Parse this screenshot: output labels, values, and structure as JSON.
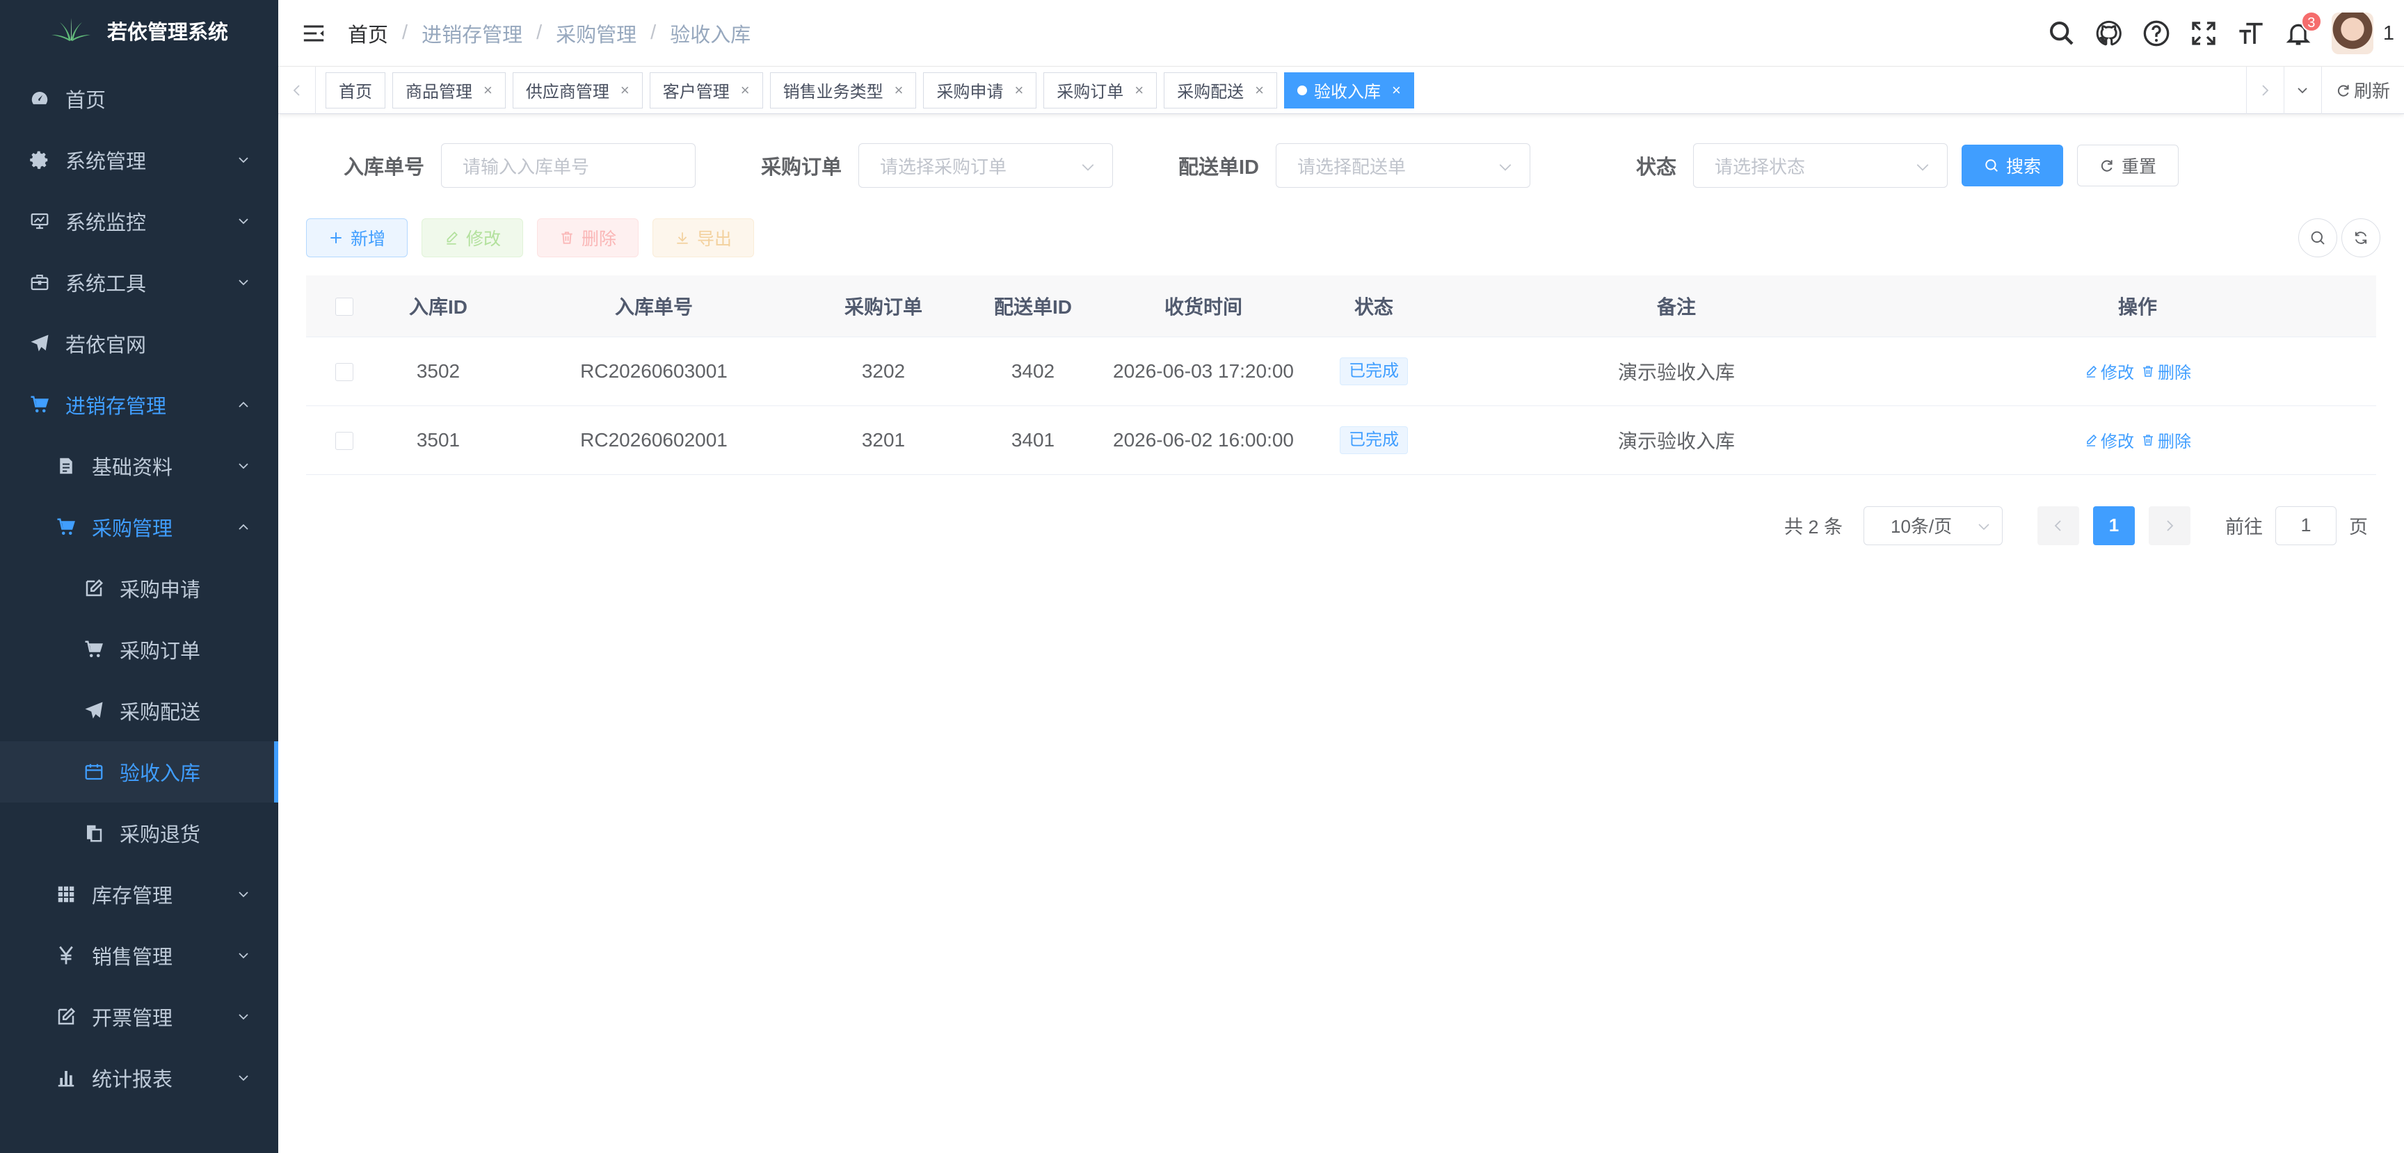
{
  "app": {
    "title": "若依管理系统"
  },
  "sidebar": {
    "items": [
      {
        "label": "首页"
      },
      {
        "label": "系统管理"
      },
      {
        "label": "系统监控"
      },
      {
        "label": "系统工具"
      },
      {
        "label": "若依官网"
      },
      {
        "label": "进销存管理"
      },
      {
        "label": "基础资料"
      },
      {
        "label": "采购管理"
      },
      {
        "label": "采购申请"
      },
      {
        "label": "采购订单"
      },
      {
        "label": "采购配送"
      },
      {
        "label": "验收入库"
      },
      {
        "label": "采购退货"
      },
      {
        "label": "库存管理"
      },
      {
        "label": "销售管理"
      },
      {
        "label": "开票管理"
      },
      {
        "label": "统计报表"
      }
    ]
  },
  "header": {
    "breadcrumb": [
      "首页",
      "进销存管理",
      "采购管理",
      "验收入库"
    ],
    "notification_count": "3",
    "user_name": "1"
  },
  "tags": [
    {
      "label": "首页"
    },
    {
      "label": "商品管理"
    },
    {
      "label": "供应商管理"
    },
    {
      "label": "客户管理"
    },
    {
      "label": "销售业务类型"
    },
    {
      "label": "采购申请"
    },
    {
      "label": "采购订单"
    },
    {
      "label": "采购配送"
    },
    {
      "label": "验收入库"
    }
  ],
  "tagbar": {
    "refresh_label": "刷新"
  },
  "search": {
    "receipt_no_label": "入库单号",
    "receipt_no_placeholder": "请输入入库单号",
    "po_label": "采购订单",
    "po_placeholder": "请选择采购订单",
    "delivery_label": "配送单ID",
    "delivery_placeholder": "请选择配送单",
    "status_label": "状态",
    "status_placeholder": "请选择状态",
    "search_btn": "搜索",
    "reset_btn": "重置"
  },
  "toolbar": {
    "add": "新增",
    "edit": "修改",
    "delete": "删除",
    "export": "导出"
  },
  "table": {
    "columns": [
      "入库ID",
      "入库单号",
      "采购订单",
      "配送单ID",
      "收货时间",
      "状态",
      "备注",
      "操作"
    ],
    "rows": [
      {
        "id": "3502",
        "no": "RC20260603001",
        "po": "3202",
        "delivery": "3402",
        "time": "2026-06-03 17:20:00",
        "status": "已完成",
        "remark": "演示验收入库",
        "edit": "修改",
        "del": "删除"
      },
      {
        "id": "3501",
        "no": "RC20260602001",
        "po": "3201",
        "delivery": "3401",
        "time": "2026-06-02 16:00:00",
        "status": "已完成",
        "remark": "演示验收入库",
        "edit": "修改",
        "del": "删除"
      }
    ]
  },
  "pagination": {
    "total": "共 2 条",
    "page_size": "10条/页",
    "current": "1",
    "goto_label": "前往",
    "goto_value": "1",
    "page_unit": "页"
  },
  "colors": {
    "primary": "#409eff",
    "sidebar_bg": "#1f2d3d"
  }
}
